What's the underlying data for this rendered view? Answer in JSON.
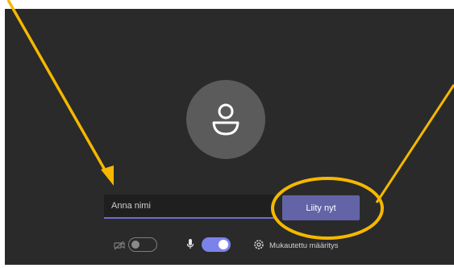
{
  "prejoin": {
    "name_input": {
      "placeholder": "Anna nimi",
      "value": ""
    },
    "join_button_label": "Liity nyt",
    "camera_toggle": {
      "state": "off",
      "icon": "camera-off-icon"
    },
    "mic_toggle": {
      "state": "on",
      "icon": "microphone-icon"
    },
    "device_settings": {
      "icon": "gear-icon",
      "label": "Mukautettu määritys"
    },
    "avatar_icon": "person-icon"
  },
  "annotation": {
    "color": "#f5b800",
    "arrows": [
      "arrow-to-name-input",
      "arrow-to-join-button"
    ],
    "highlight": "ellipse-around-join-button"
  },
  "colors": {
    "panel_background": "#2a2a2a",
    "avatar_background": "#5b5b5b",
    "accent": "#6264a7",
    "toggle_on": "#7b83eb"
  }
}
